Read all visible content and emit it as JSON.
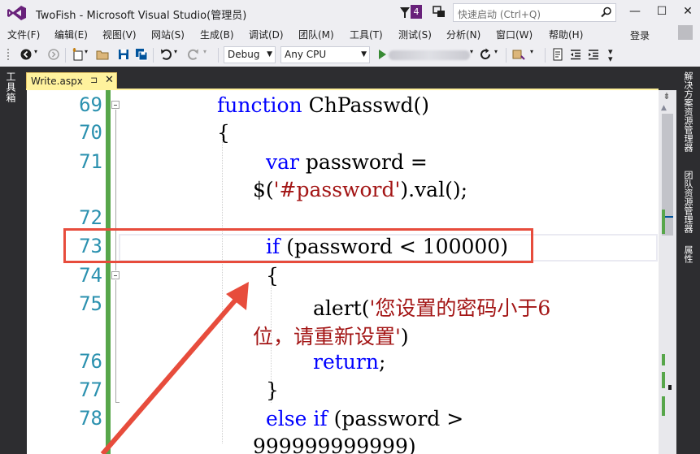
{
  "title_bar": {
    "app_title": "TwoFish - Microsoft Visual Studio(管理员)",
    "notification_count": "4",
    "quick_launch_placeholder": "快速启动 (Ctrl+Q)",
    "window_controls": {
      "minimize": "—",
      "maximize": "☐",
      "close": "✕"
    }
  },
  "menu": {
    "items": [
      "文件(F)",
      "编辑(E)",
      "视图(V)",
      "网站(S)",
      "生成(B)",
      "调试(D)",
      "团队(M)",
      "工具(T)",
      "测试(S)",
      "分析(N)",
      "窗口(W)",
      "帮助(H)"
    ],
    "sign_in": "登录"
  },
  "toolbar": {
    "configuration": "Debug",
    "platform": "Any CPU"
  },
  "side_tabs": {
    "left": "工具箱",
    "right": [
      "解决方案资源管理器",
      "团队资源管理器",
      "属性"
    ]
  },
  "document_tab": {
    "name": "Write.aspx",
    "pin": "⊐",
    "close": "✕"
  },
  "editor": {
    "line_numbers": [
      "69",
      "70",
      "71",
      "72",
      "73",
      "74",
      "75",
      "76",
      "77",
      "78"
    ],
    "lines": [
      {
        "tokens": [
          {
            "kw": "function"
          },
          {
            "t": " ChPasswd()"
          }
        ]
      },
      {
        "tokens": [
          {
            "t": "{"
          }
        ]
      },
      {
        "tokens": [
          {
            "kw": "var"
          },
          {
            "t": " password ="
          }
        ]
      },
      {
        "tokens": [
          {
            "t": "$("
          },
          {
            "str": "'#password'"
          },
          {
            "t": ").val();"
          }
        ]
      },
      {
        "tokens": [
          {
            "kw": "if"
          },
          {
            "t": " (password < 100000)"
          }
        ]
      },
      {
        "tokens": [
          {
            "t": "{"
          }
        ]
      },
      {
        "tokens": [
          {
            "t": "alert("
          },
          {
            "str": "'您设置的密码小于6"
          }
        ]
      },
      {
        "tokens": [
          {
            "str": "位，请重新设置'"
          },
          {
            "t": ")"
          }
        ]
      },
      {
        "tokens": [
          {
            "kw": "return"
          },
          {
            "t": ";"
          }
        ]
      },
      {
        "tokens": [
          {
            "t": "}"
          }
        ]
      },
      {
        "tokens": [
          {
            "kw": "else"
          },
          {
            "t": " "
          },
          {
            "kw": "if"
          },
          {
            "t": " (password >"
          }
        ]
      },
      {
        "tokens": [
          {
            "t": "999999999999)"
          }
        ]
      }
    ]
  },
  "colors": {
    "keyword": "#0000ff",
    "string": "#a31515",
    "line_number": "#2b91af",
    "change_bar": "#57a64a",
    "annotation": "#e74c3c",
    "vs_purple": "#68217a"
  }
}
